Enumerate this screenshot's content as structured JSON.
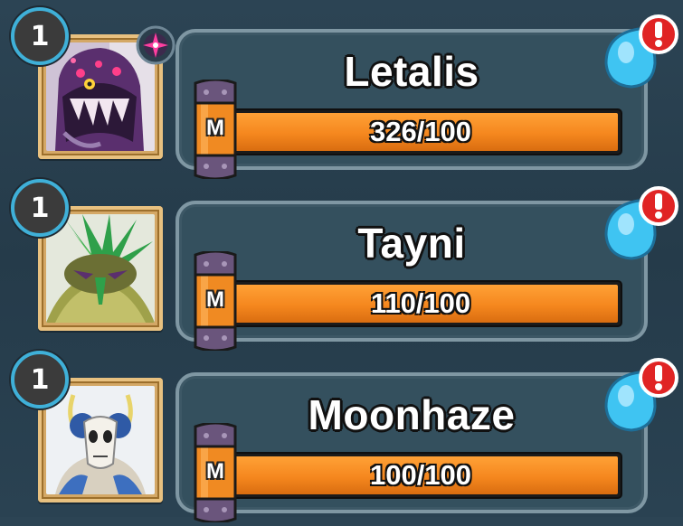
{
  "monsters": [
    {
      "level": "1",
      "name": "Letalis",
      "progress_text": "326/100",
      "progress": 1.0,
      "capsule_label": "M",
      "has_rank_emblem": true,
      "alert_icon": "exclamation-icon",
      "portrait_icon": "letalis-portrait"
    },
    {
      "level": "1",
      "name": "Tayni",
      "progress_text": "110/100",
      "progress": 1.0,
      "capsule_label": "M",
      "has_rank_emblem": false,
      "alert_icon": "exclamation-icon",
      "portrait_icon": "tayni-portrait"
    },
    {
      "level": "1",
      "name": "Moonhaze",
      "progress_text": "100/100",
      "progress": 1.0,
      "capsule_label": "M",
      "has_rank_emblem": false,
      "alert_icon": "exclamation-icon",
      "portrait_icon": "moonhaze-portrait"
    }
  ],
  "colors": {
    "background": "#2a4252",
    "panel": "#34505e",
    "bar_fill": "#f5871e",
    "level_ring": "#3fb0d8",
    "alert_red": "#e02424",
    "alert_blue": "#3fc4f2",
    "portrait_frame": "#d4a866",
    "capsule_purple": "#6a557c",
    "capsule_orange": "#f08a22"
  }
}
